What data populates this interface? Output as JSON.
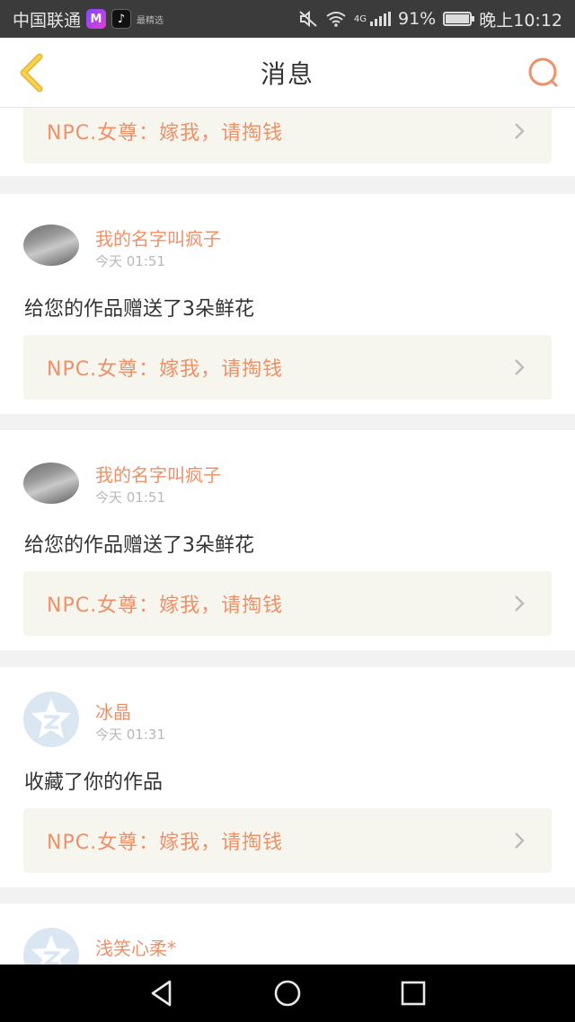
{
  "status_bar": {
    "carrier": "中国联通",
    "app_badge_m": "M",
    "app_badge_tt": "♪",
    "tiny_text": "最精选",
    "network": "4G",
    "battery_percent": "91%",
    "battery_level": 0.91,
    "time": "晚上10:12"
  },
  "header": {
    "title": "消息"
  },
  "messages": [
    {
      "work_title": "NPC.女尊：嫁我，请掏钱"
    },
    {
      "user": "我的名字叫疯子",
      "time": "今天 01:51",
      "text": "给您的作品赠送了3朵鲜花",
      "work_title": "NPC.女尊：嫁我，请掏钱",
      "avatar": "photo"
    },
    {
      "user": "我的名字叫疯子",
      "time": "今天 01:51",
      "text": "给您的作品赠送了3朵鲜花",
      "work_title": "NPC.女尊：嫁我，请掏钱",
      "avatar": "photo"
    },
    {
      "user": "冰晶",
      "time": "今天 01:31",
      "text": "收藏了你的作品",
      "work_title": "NPC.女尊：嫁我，请掏钱",
      "avatar": "default"
    },
    {
      "user": "浅笑心柔*",
      "avatar": "default"
    }
  ],
  "colors": {
    "accent": "#ee9068",
    "back_icon": "#f0c040",
    "work_box_bg": "#f6f6ee"
  }
}
